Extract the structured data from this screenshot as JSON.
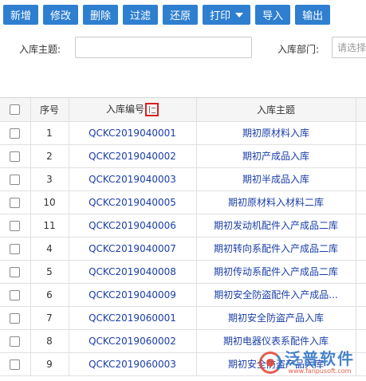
{
  "toolbar": {
    "buttons": [
      {
        "label": "新增"
      },
      {
        "label": "修改"
      },
      {
        "label": "删除"
      },
      {
        "label": "过滤"
      },
      {
        "label": "还原"
      },
      {
        "label": "打印"
      },
      {
        "label": "导入"
      },
      {
        "label": "输出"
      }
    ],
    "accent": "#2f7fd0"
  },
  "filter": {
    "subject_label": "入库主题:",
    "subject_value": "",
    "dept_label": "入库部门:",
    "dept_placeholder": "请选择"
  },
  "grid": {
    "columns": [
      "序号",
      "入库编号",
      "入库主题"
    ],
    "rows": [
      {
        "seq": "1",
        "code": "QCKC2019040001",
        "subject": "期初原材料入库"
      },
      {
        "seq": "2",
        "code": "QCKC2019040002",
        "subject": "期初产成品入库"
      },
      {
        "seq": "3",
        "code": "QCKC2019040003",
        "subject": "期初半成品入库"
      },
      {
        "seq": "10",
        "code": "QCKC2019040005",
        "subject": "期初原材料入材料二库"
      },
      {
        "seq": "11",
        "code": "QCKC2019040006",
        "subject": "期初发动机配件入产成品二库"
      },
      {
        "seq": "4",
        "code": "QCKC2019040007",
        "subject": "期初转向系配件入产成品二库"
      },
      {
        "seq": "5",
        "code": "QCKC2019040008",
        "subject": "期初传动系配件入产成品二库"
      },
      {
        "seq": "6",
        "code": "QCKC2019040009",
        "subject": "期初安全防盗配件入产成品..."
      },
      {
        "seq": "7",
        "code": "QCKC2019060001",
        "subject": "期初安全防盗产品入库"
      },
      {
        "seq": "8",
        "code": "QCKC2019060002",
        "subject": "期初电器仪表系配件入库"
      },
      {
        "seq": "9",
        "code": "QCKC2019060003",
        "subject": "期初安全防盗产品入库"
      }
    ],
    "link_color": "#1a3ea8",
    "sort_highlight_color": "#e02020"
  },
  "watermark": {
    "main": "泛普软件",
    "url": "www.fanpusoft.com"
  }
}
